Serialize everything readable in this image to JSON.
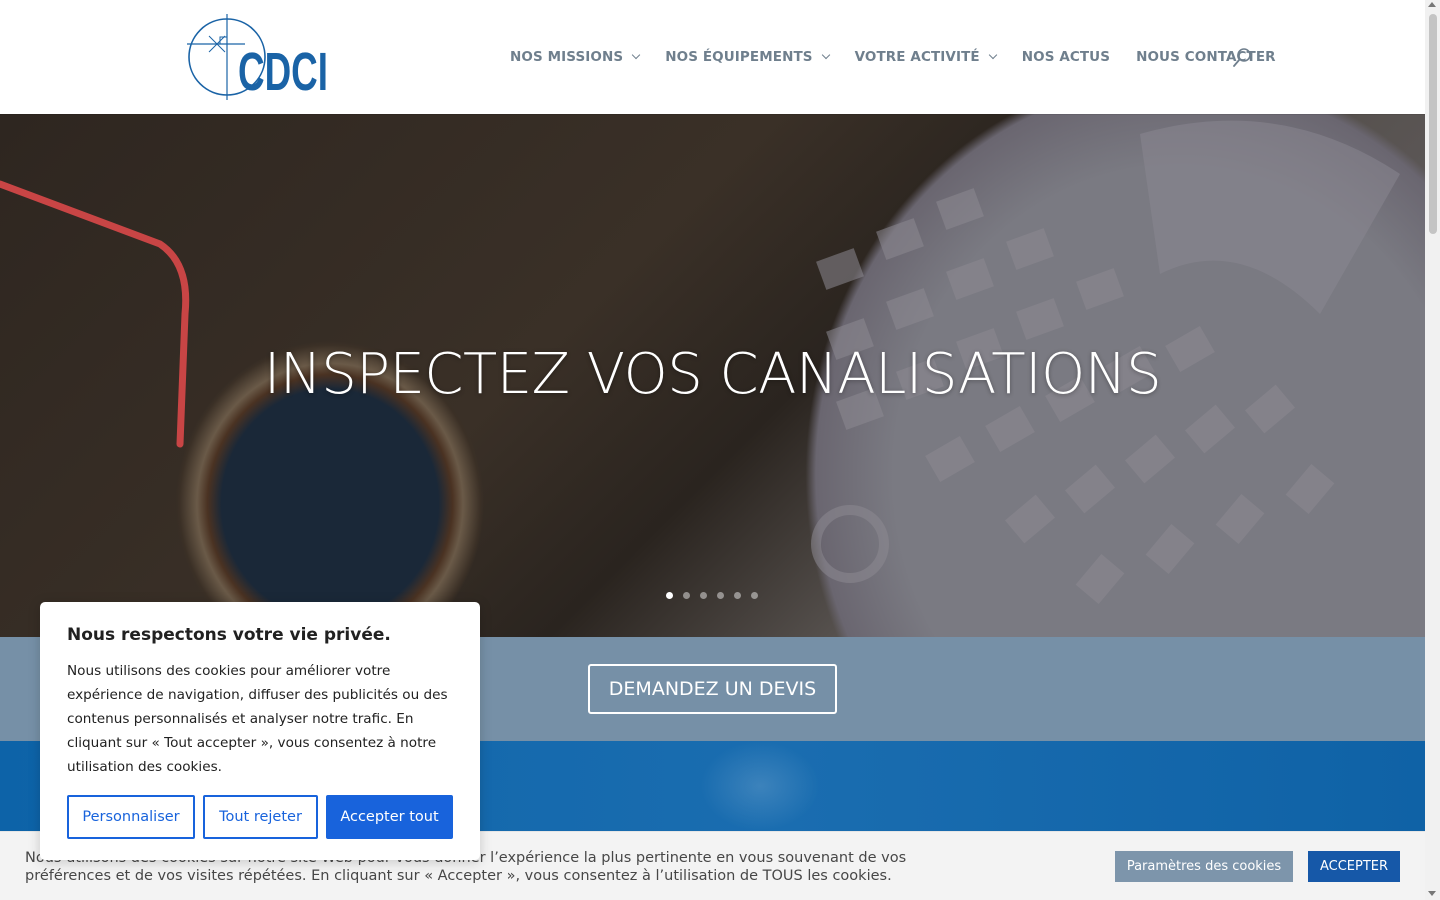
{
  "header": {
    "logo_text": "CDCI",
    "nav": [
      {
        "label": "NOS MISSIONS",
        "has_dropdown": true
      },
      {
        "label": "NOS ÉQUIPEMENTS",
        "has_dropdown": true
      },
      {
        "label": "VOTRE ACTIVITÉ",
        "has_dropdown": true
      },
      {
        "label": "NOS ACTUS",
        "has_dropdown": false
      },
      {
        "label": "NOUS CONTACTER",
        "has_dropdown": false
      }
    ],
    "search_icon": "search-icon"
  },
  "hero": {
    "title": "INSPECTEZ VOS CANALISATIONS",
    "slide_count": 6,
    "active_slide": 1
  },
  "cta": {
    "label": "DEMANDEZ UN DEVIS"
  },
  "privacy_popup": {
    "title": "Nous respectons votre vie privée.",
    "body": "Nous utilisons des cookies pour améliorer votre expérience de navigation, diffuser des publicités ou des contenus personnalisés et analyser notre trafic. En cliquant sur « Tout accepter », vous consentez à notre utilisation des cookies.",
    "customize_label": "Personnaliser",
    "reject_label": "Tout rejeter",
    "accept_label": "Accepter tout"
  },
  "cookie_bar": {
    "text": "Nous utilisons des cookies sur notre site Web pour vous donner l’expérience la plus pertinente en vous souvenant de vos préférences et de vos visites répétées. En cliquant sur « Accepter », vous consentez à l’utilisation de TOUS les cookies.",
    "settings_label": "Paramètres des cookies",
    "accept_label": "ACCEPTER"
  },
  "colors": {
    "brand_blue": "#1a63a6",
    "nav_text": "#6f7f8d",
    "cta_band": "#7690a7",
    "popup_accent": "#1863dc",
    "cookie_accept": "#1658a8",
    "cookie_settings": "#7d95ab"
  }
}
